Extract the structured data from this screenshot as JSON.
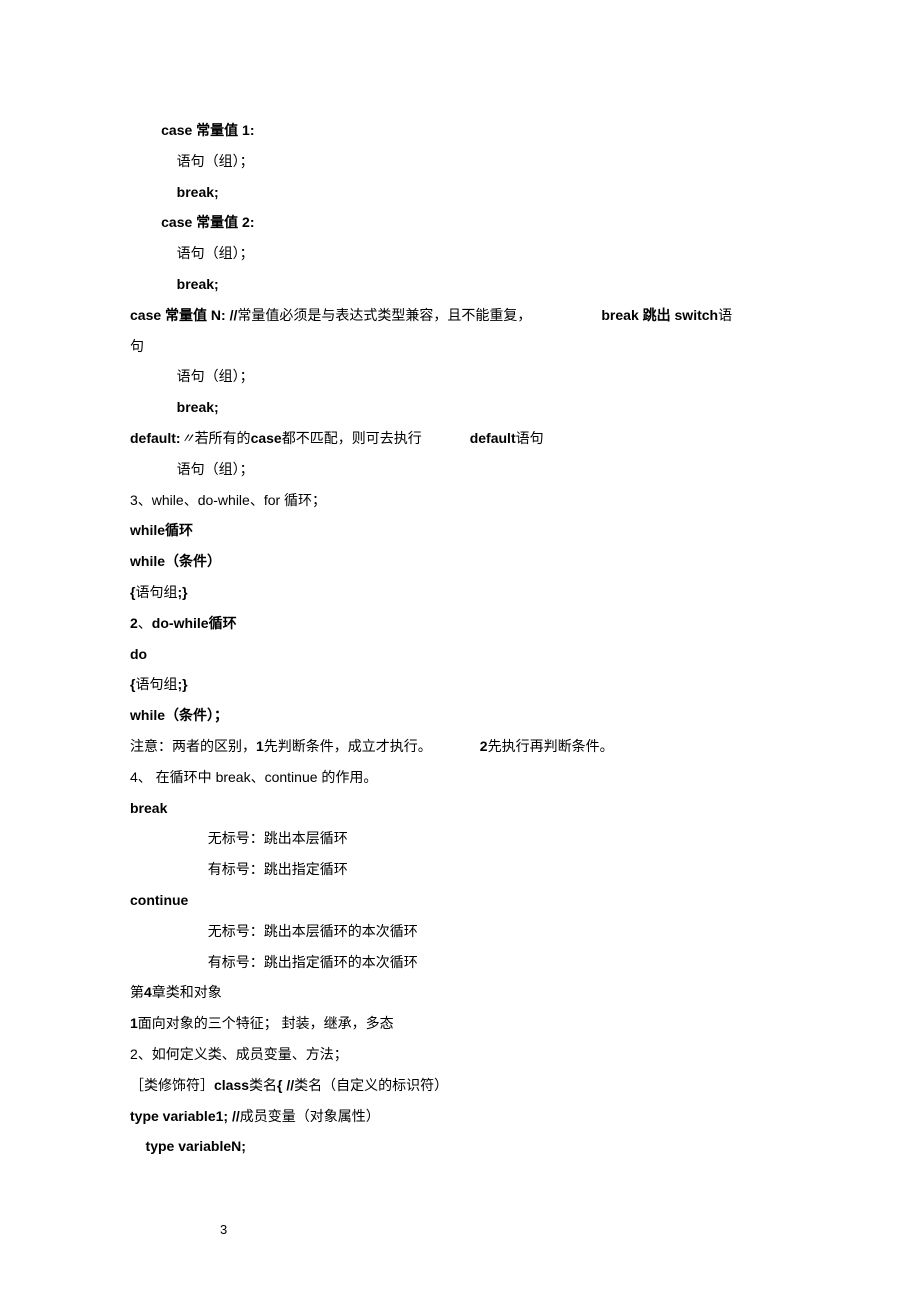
{
  "lines": {
    "l1": "        case 常量值 1:",
    "l2": "            语句（组）；",
    "l3": "            break;",
    "l4": "        case 常量值 2:",
    "l5": "            语句（组）；",
    "l6": "            break;",
    "l7a": "        case 常量值 N: //",
    "l7b": "常量值必须是与表达式类型兼容，且不能重复，",
    "l7c": "break 跳出 switch",
    "l7d": " 语",
    "l8": "句",
    "l9": "            语句（组）；",
    "l10": "            break;",
    "l11a": "        default:",
    "l11b": " 〃",
    "l11c": "若所有的 ",
    "l11d": "case ",
    "l11e": "都不匹配，则可去执行",
    "l11f": "default ",
    "l11g": "语句",
    "l12": "            语句（组）；",
    "l13": "3、while、do-while、for 循环；",
    "l14a": "while ",
    "l14b": "循环",
    "l15a": "    while",
    "l15b": "（条件）",
    "l16a": "           {",
    "l16b": "语句组",
    "l16c": ";}",
    "l17a": "2",
    "l17b": "、",
    "l17c": "do-while ",
    "l17d": "循环",
    "l18": "do",
    "l19a": "{",
    "l19b": "语句组",
    "l19c": ";}",
    "l20a": "       while",
    "l20b": "（条件）；",
    "l21a": "注意：两者的区别，",
    "l21b": "1 ",
    "l21c": "先判断条件，成立才执行。",
    "l21d": "2 ",
    "l21e": "先执行再判断条件。",
    "l22": "4、 在循环中 break、continue 的作用。",
    "l23": "break",
    "l24": "                    无标号：跳出本层循环",
    "l25": "                    有标号：跳出指定循环",
    "l26": "continue",
    "l27": "                    无标号：跳出本层循环的本次循环",
    "l28": "                    有标号：跳出指定循环的本次循环",
    "l29a": "第 ",
    "l29b": "4 ",
    "l29c": "章类和对象",
    "l30a": "1 ",
    "l30b": "面向对象的三个特征；          封装，继承，多态",
    "l31": "2、如何定义类、成员变量、方法；",
    "l32a": "［类修饰符］",
    "l32b": "class ",
    "l32c": "类名",
    "l32d": "{ //",
    "l32e": "类名（自定义的标识符）",
    "l33a": "    type variable1; //",
    "l33b": "成员变量（对象属性）",
    "l34": "",
    "l35": "    type variableN;",
    "pagenum": "3"
  }
}
